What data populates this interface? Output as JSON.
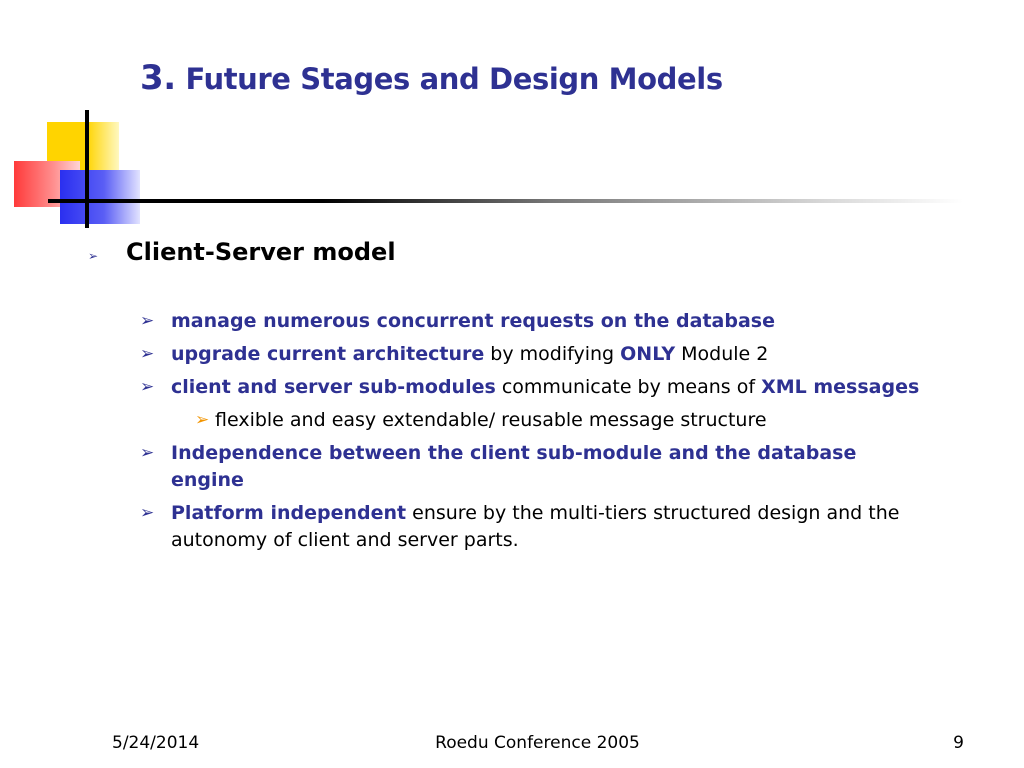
{
  "slide": {
    "title_number": "3.",
    "title_text": "Future Stages and Design Models"
  },
  "level1": {
    "arrow": "➢",
    "text": "Client-Server model"
  },
  "items": [
    {
      "arrow": "➢",
      "p1_hl": "manage numerous concurrent requests on the database"
    },
    {
      "arrow": "➢",
      "p1_hl": "upgrade current architecture",
      "p2": " by modifying ",
      "p3_hl": "ONLY",
      "p4": " Module 2"
    },
    {
      "arrow": "➢",
      "p1_hl": "client and server sub-modules",
      "p2": " communicate by means of ",
      "p3_hl": "XML messages"
    },
    {
      "arrow": "➢",
      "p1": "flexible and easy extendable/ reusable message structure"
    },
    {
      "arrow": "➢",
      "p1_hl": "Independence between the client sub-module and the database engine"
    },
    {
      "arrow": "➢",
      "p1_hl": "Platform independent",
      "p2": " ensure by the multi-tiers structured design and the autonomy of client and server parts."
    }
  ],
  "footer": {
    "date": "5/24/2014",
    "conference": "Roedu Conference 2005",
    "page": "9"
  }
}
